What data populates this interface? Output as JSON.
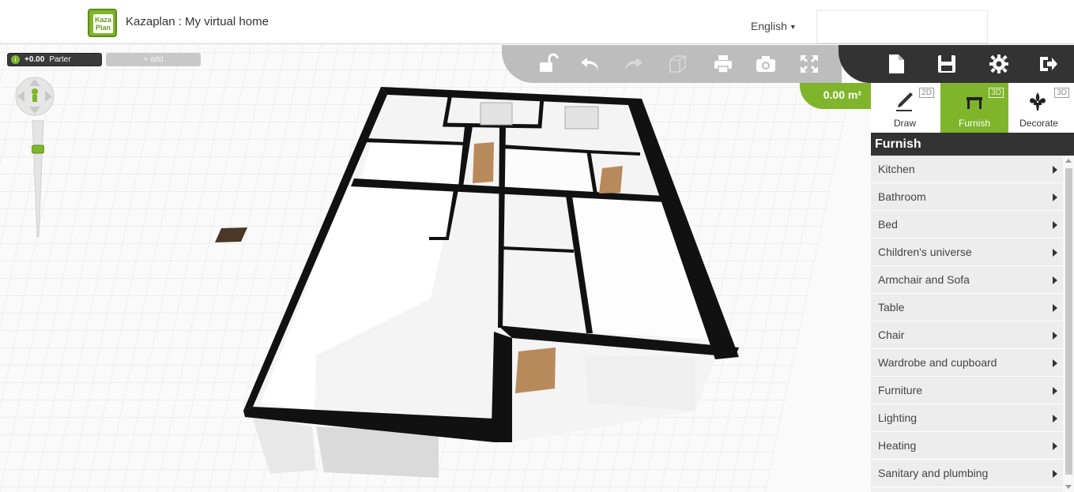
{
  "header": {
    "logo_text_top": "Kaza",
    "logo_text_bottom": "Plan",
    "app_title": "Kazaplan : My virtual home",
    "language": "English"
  },
  "levels": {
    "current_height": "+0.00",
    "current_name": "Parter",
    "add_label": "+ add"
  },
  "toolbar": {
    "icons": [
      "lock-open-icon",
      "undo-icon",
      "redo-icon",
      "cube-icon",
      "print-icon",
      "camera-icon",
      "fullscreen-icon"
    ],
    "file_icons": [
      "new-file-icon",
      "save-icon",
      "settings-gear-icon",
      "logout-icon"
    ]
  },
  "area": {
    "value": "0.00 m²"
  },
  "modes": [
    {
      "label": "Draw",
      "dim": "2D"
    },
    {
      "label": "Furnish",
      "dim": "3D"
    },
    {
      "label": "Decorate",
      "dim": "3D"
    }
  ],
  "panel": {
    "title": "Furnish",
    "categories": [
      "Kitchen",
      "Bathroom",
      "Bed",
      "Children's universe",
      "Armchair and Sofa",
      "Table",
      "Chair",
      "Wardrobe and cupboard",
      "Furniture",
      "Lighting",
      "Heating",
      "Sanitary and plumbing"
    ]
  },
  "colors": {
    "accent": "#7fb52b",
    "dark": "#333333",
    "toolbar": "#bdbdbd"
  }
}
